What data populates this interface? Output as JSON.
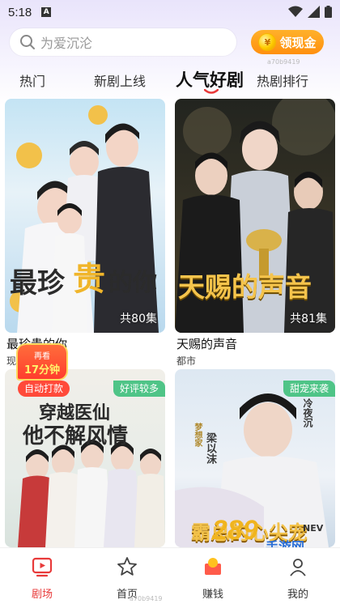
{
  "status_bar": {
    "time": "5:18",
    "badge": "A"
  },
  "search": {
    "placeholder": "为爱沉沦"
  },
  "earn_button": {
    "label": "领现金",
    "coin_symbol": "¥"
  },
  "watermark": "a70b9419",
  "tabs": [
    {
      "label": "热门",
      "active": false
    },
    {
      "label": "新剧上线",
      "active": false
    },
    {
      "label": "人气好剧",
      "active": true
    },
    {
      "label": "热剧排行",
      "active": false
    }
  ],
  "colors": {
    "accent_red": "#e83a3a",
    "gold": "#ff9d1a",
    "green_badge": "#4fc487"
  },
  "cards": [
    {
      "title": "最珍贵的你",
      "genre": "现代",
      "episodes": "共80集",
      "poster_text": [
        "最珍",
        "贵",
        "的你"
      ]
    },
    {
      "title": "天赐的声音",
      "genre": "都市",
      "episodes": "共81集",
      "poster_text": "天赐的声音"
    },
    {
      "badge": "好评较多",
      "poster_text": [
        "穿越医仙",
        "他不解风情"
      ]
    },
    {
      "badge": "甜宠来袭",
      "poster_names": {
        "male": "冷夜沉",
        "female": "梁以沫",
        "female_tag": "梦想家"
      },
      "poster_text": "霸总的心尖宠"
    }
  ],
  "promo": {
    "watch_line1": "再看",
    "watch_line2": "17分钟",
    "auto_label": "自动打款"
  },
  "bottom_nav": [
    {
      "label": "剧场",
      "icon": "theater-icon",
      "active": true
    },
    {
      "label": "首页",
      "icon": "star-icon",
      "active": false
    },
    {
      "label": "赚钱",
      "icon": "money-icon",
      "active": false
    },
    {
      "label": "我的",
      "icon": "profile-icon",
      "active": false
    }
  ],
  "site_watermark": {
    "number": "289",
    "text": "手游网",
    "tag": "NEV"
  }
}
